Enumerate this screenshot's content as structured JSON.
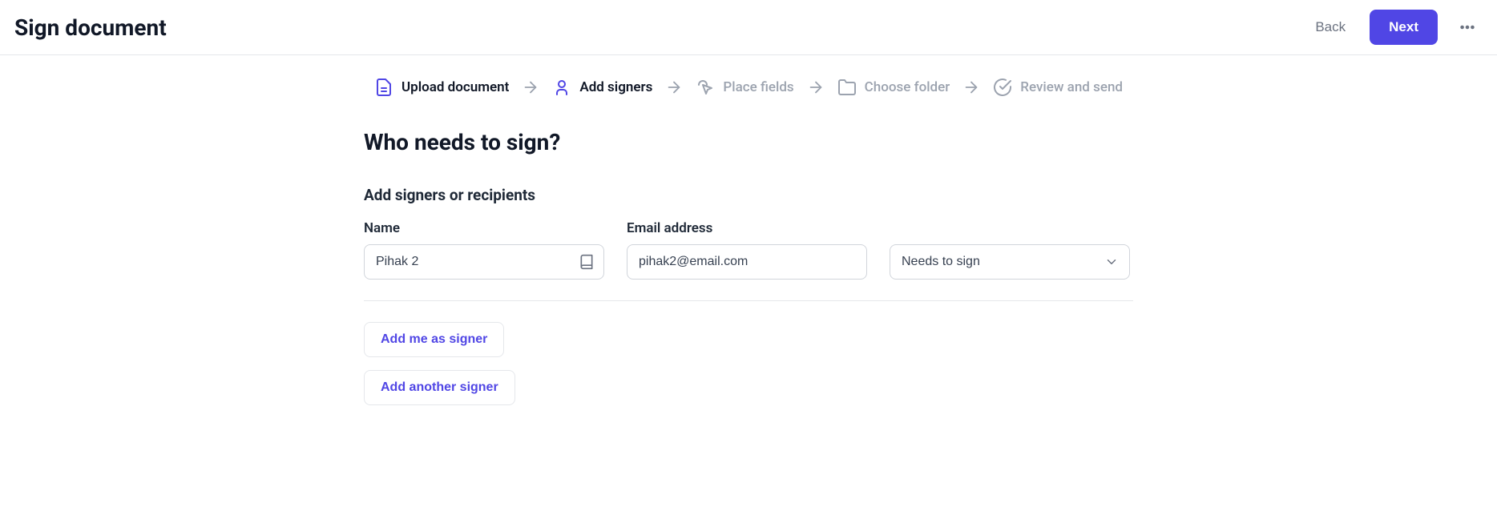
{
  "header": {
    "title": "Sign document",
    "back": "Back",
    "next": "Next"
  },
  "steps": {
    "upload": "Upload document",
    "addsigners": "Add signers",
    "placefields": "Place fields",
    "choosefolder": "Choose folder",
    "review": "Review and send"
  },
  "main": {
    "heading": "Who needs to sign?",
    "subheading": "Add signers or recipients",
    "labels": {
      "name": "Name",
      "email": "Email address"
    },
    "signer": {
      "name": "Pihak 2",
      "email": "pihak2@email.com",
      "role": "Needs to sign"
    },
    "buttons": {
      "addme": "Add me as signer",
      "addanother": "Add another signer"
    }
  },
  "colors": {
    "primary": "#5046e5"
  }
}
